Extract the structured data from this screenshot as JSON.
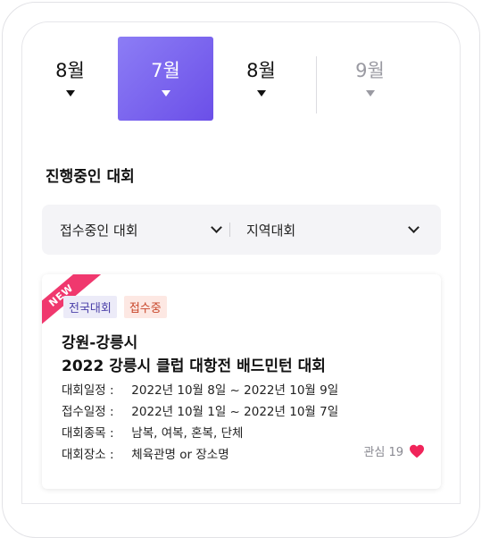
{
  "month_tabs": [
    {
      "label": "8월",
      "state": "normal"
    },
    {
      "label": "7월",
      "state": "active"
    },
    {
      "label": "8월",
      "state": "normal"
    },
    {
      "label": "9월",
      "state": "dim"
    }
  ],
  "section": {
    "title": "진행중인 대회",
    "filters": {
      "status": {
        "label": "접수중인 대회",
        "icon": "chevron-down-icon"
      },
      "scope": {
        "label": "지역대회",
        "icon": "chevron-down-icon"
      }
    }
  },
  "card": {
    "ribbon": "NEW",
    "tags": {
      "national": "전국대회",
      "open": "접수중"
    },
    "region": "강원-강릉시",
    "title": "2022 강릉시 클럽 대항전 배드민턴 대회",
    "rows": [
      {
        "key": "대회일정 :",
        "value": "2022년 10월 8일 ~ 2022년 10월 9일"
      },
      {
        "key": "접수일정 :",
        "value": "2022년 10월 1일 ~ 2022년 10월 7일"
      },
      {
        "key": "대회종목 :",
        "value": "남복, 여복, 혼복, 단체"
      },
      {
        "key": "대회장소 :",
        "value": "체육관명 or 장소명"
      }
    ],
    "like": {
      "label": "관심 19",
      "icon": "heart-icon",
      "color": "#f0245a"
    }
  },
  "colors": {
    "accent_start": "#8c7df5",
    "accent_end": "#6b4fe8",
    "ribbon": "#f0386e"
  }
}
